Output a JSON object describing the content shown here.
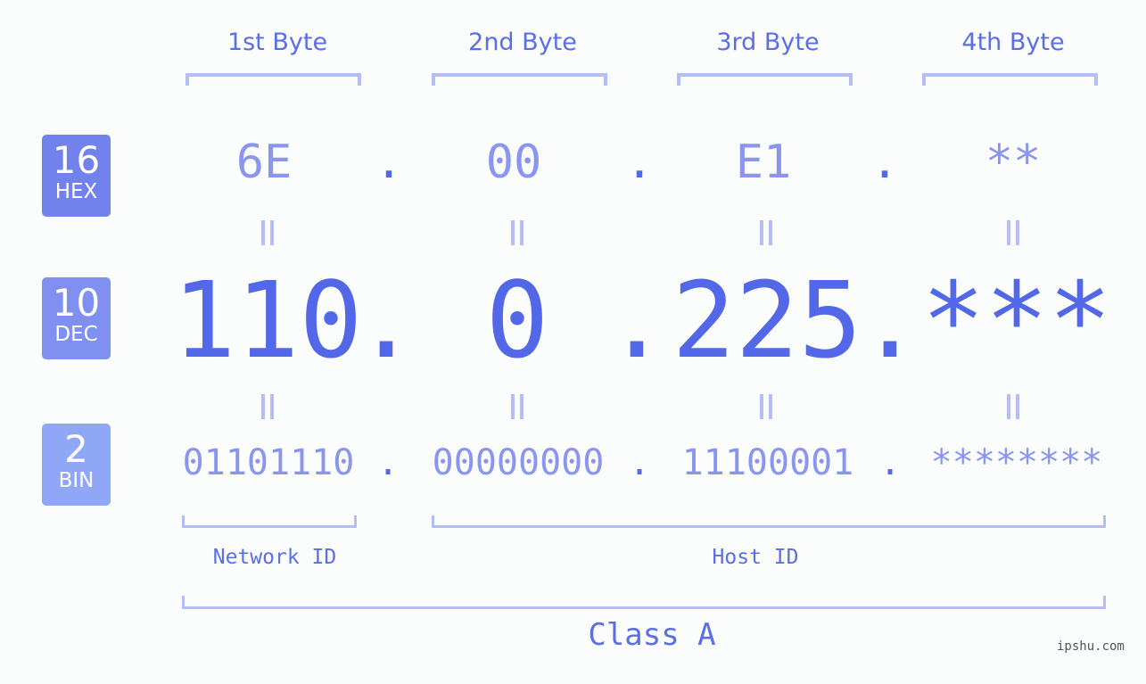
{
  "byte_headers": [
    "1st Byte",
    "2nd Byte",
    "3rd Byte",
    "4th Byte"
  ],
  "badges": [
    {
      "number": "16",
      "name": "HEX",
      "color": "#7282ed"
    },
    {
      "number": "10",
      "name": "DEC",
      "color": "#8090f0"
    },
    {
      "number": "2",
      "name": "BIN",
      "color": "#90a6f7"
    }
  ],
  "hex": [
    "6E",
    "00",
    "E1",
    "**"
  ],
  "dec": [
    "110",
    "0",
    "225",
    "***"
  ],
  "bin": [
    "01101110",
    "00000000",
    "11100001",
    "********"
  ],
  "separator": ".",
  "network_label": "Network ID",
  "host_label": "Host ID",
  "class_label": "Class A",
  "watermark": "ipshu.com",
  "colors": {
    "accent": "#5268e8",
    "light": "#8a95ef",
    "bracket": "#b3bdf6"
  }
}
